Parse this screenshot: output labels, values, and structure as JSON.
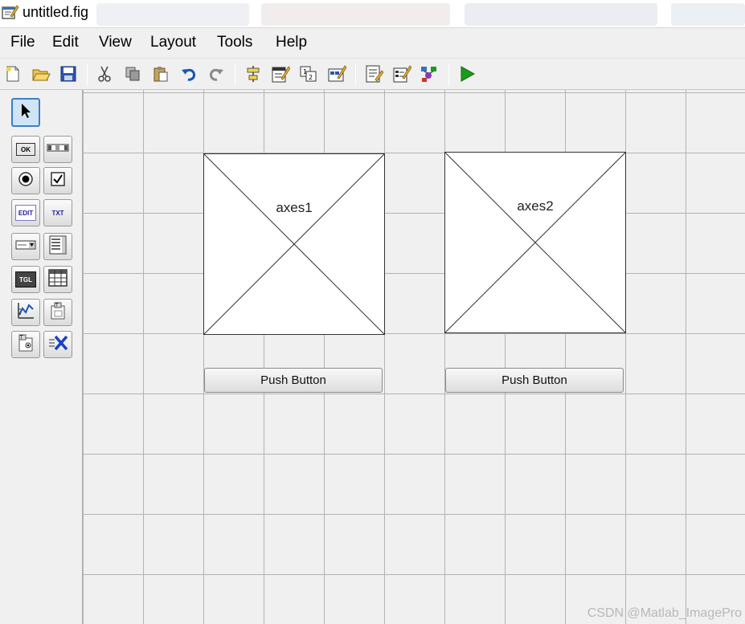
{
  "window": {
    "title": "untitled.fig"
  },
  "menu": [
    "File",
    "Edit",
    "View",
    "Layout",
    "Tools",
    "Help"
  ],
  "toolbar": {
    "icons": [
      "new-figure-icon",
      "open-file-icon",
      "save-icon",
      "cut-icon",
      "copy-icon",
      "paste-icon",
      "undo-icon",
      "redo-icon",
      "align-objects-icon",
      "menu-editor-icon",
      "tab-order-editor-icon",
      "toolbar-editor-icon",
      "mfile-editor-icon",
      "property-inspector-icon",
      "object-browser-icon",
      "run-figure-icon"
    ],
    "colors": {
      "accent_green": "#1a9b1a",
      "accent_blue": "#1a55b8"
    }
  },
  "palette": {
    "tools": [
      {
        "name": "select-tool",
        "label": ""
      },
      {
        "name": "push-button-tool",
        "label": "OK"
      },
      {
        "name": "slider-tool",
        "label": ""
      },
      {
        "name": "radio-button-tool",
        "label": ""
      },
      {
        "name": "check-box-tool",
        "label": ""
      },
      {
        "name": "edit-text-tool",
        "label": "EDIT"
      },
      {
        "name": "static-text-tool",
        "label": "TXT"
      },
      {
        "name": "pop-up-menu-tool",
        "label": ""
      },
      {
        "name": "list-box-tool",
        "label": ""
      },
      {
        "name": "toggle-button-tool",
        "label": "TGL"
      },
      {
        "name": "table-tool",
        "label": ""
      },
      {
        "name": "axes-tool",
        "label": ""
      },
      {
        "name": "panel-tool",
        "label": ""
      },
      {
        "name": "button-group-tool",
        "label": ""
      },
      {
        "name": "activex-control-tool",
        "label": ""
      }
    ]
  },
  "canvas": {
    "axes": [
      {
        "label": "axes1"
      },
      {
        "label": "axes2"
      }
    ],
    "buttons": [
      {
        "label": "Push Button"
      },
      {
        "label": "Push Button"
      }
    ]
  },
  "watermark": "CSDN @Matlab_ImagePro"
}
